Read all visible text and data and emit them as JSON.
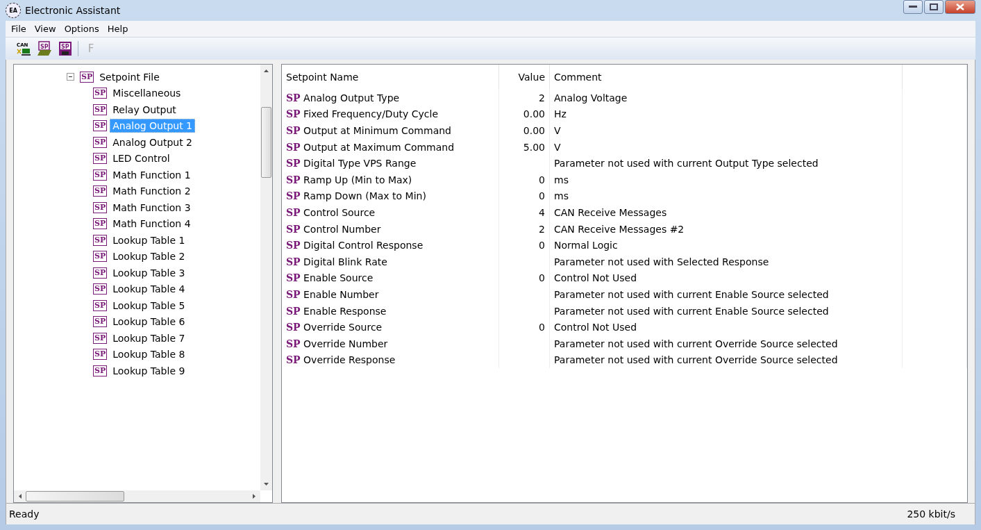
{
  "window": {
    "title": "Electronic Assistant",
    "logo_text": "EA"
  },
  "menu": [
    "File",
    "View",
    "Options",
    "Help"
  ],
  "toolbar": [
    {
      "kind": "can",
      "label": "CAN",
      "disabled": false
    },
    {
      "kind": "open",
      "label": "SP",
      "disabled": false
    },
    {
      "kind": "save",
      "label": "SP",
      "disabled": false
    },
    {
      "kind": "separator"
    },
    {
      "kind": "text",
      "label": "F",
      "disabled": true
    }
  ],
  "tree": {
    "label": "Setpoint File",
    "badge": "SP",
    "expanded": true,
    "children": [
      {
        "label": "Miscellaneous",
        "badge": "SP",
        "selected": false
      },
      {
        "label": "Relay Output",
        "badge": "SP",
        "selected": false
      },
      {
        "label": "Analog Output 1",
        "badge": "SP",
        "selected": true
      },
      {
        "label": "Analog Output 2",
        "badge": "SP",
        "selected": false
      },
      {
        "label": "LED Control",
        "badge": "SP",
        "selected": false
      },
      {
        "label": "Math Function 1",
        "badge": "SP",
        "selected": false
      },
      {
        "label": "Math Function 2",
        "badge": "SP",
        "selected": false
      },
      {
        "label": "Math Function 3",
        "badge": "SP",
        "selected": false
      },
      {
        "label": "Math Function 4",
        "badge": "SP",
        "selected": false
      },
      {
        "label": "Lookup Table 1",
        "badge": "SP",
        "selected": false
      },
      {
        "label": "Lookup Table 2",
        "badge": "SP",
        "selected": false
      },
      {
        "label": "Lookup Table 3",
        "badge": "SP",
        "selected": false
      },
      {
        "label": "Lookup Table 4",
        "badge": "SP",
        "selected": false
      },
      {
        "label": "Lookup Table 5",
        "badge": "SP",
        "selected": false
      },
      {
        "label": "Lookup Table 6",
        "badge": "SP",
        "selected": false
      },
      {
        "label": "Lookup Table 7",
        "badge": "SP",
        "selected": false
      },
      {
        "label": "Lookup Table 8",
        "badge": "SP",
        "selected": false
      },
      {
        "label": "Lookup Table 9",
        "badge": "SP",
        "selected": false
      }
    ]
  },
  "table": {
    "columns": [
      "Setpoint Name",
      "Value",
      "Comment"
    ],
    "rows": [
      {
        "badge": "SP",
        "name": "Analog Output Type",
        "value": "2",
        "comment": "Analog Voltage"
      },
      {
        "badge": "SP",
        "name": "Fixed Frequency/Duty Cycle",
        "value": "0.00",
        "comment": "Hz"
      },
      {
        "badge": "SP",
        "name": "Output at Minimum Command",
        "value": "0.00",
        "comment": "V"
      },
      {
        "badge": "SP",
        "name": "Output at Maximum Command",
        "value": "5.00",
        "comment": "V"
      },
      {
        "badge": "SP",
        "name": "Digital Type VPS Range",
        "value": "",
        "comment": "Parameter not used with current Output Type selected"
      },
      {
        "badge": "SP",
        "name": "Ramp Up (Min to Max)",
        "value": "0",
        "comment": "ms"
      },
      {
        "badge": "SP",
        "name": "Ramp Down (Max to Min)",
        "value": "0",
        "comment": "ms"
      },
      {
        "badge": "SP",
        "name": "Control Source",
        "value": "4",
        "comment": "CAN Receive Messages"
      },
      {
        "badge": "SP",
        "name": "Control Number",
        "value": "2",
        "comment": "CAN Receive Messages #2"
      },
      {
        "badge": "SP",
        "name": "Digital Control Response",
        "value": "0",
        "comment": "Normal Logic"
      },
      {
        "badge": "SP",
        "name": "Digital Blink Rate",
        "value": "",
        "comment": "Parameter not used with Selected Response"
      },
      {
        "badge": "SP",
        "name": "Enable Source",
        "value": "0",
        "comment": "Control Not Used"
      },
      {
        "badge": "SP",
        "name": "Enable Number",
        "value": "",
        "comment": "Parameter not used with current Enable Source selected"
      },
      {
        "badge": "SP",
        "name": "Enable Response",
        "value": "",
        "comment": "Parameter not used with current Enable Source selected"
      },
      {
        "badge": "SP",
        "name": "Override Source",
        "value": "0",
        "comment": "Control Not Used"
      },
      {
        "badge": "SP",
        "name": "Override Number",
        "value": "",
        "comment": "Parameter not used with current Override Source selected"
      },
      {
        "badge": "SP",
        "name": "Override Response",
        "value": "",
        "comment": "Parameter not used with current Override Source selected"
      }
    ]
  },
  "status_bar": {
    "message": "Ready",
    "bitrate": "250 kbit/s"
  }
}
